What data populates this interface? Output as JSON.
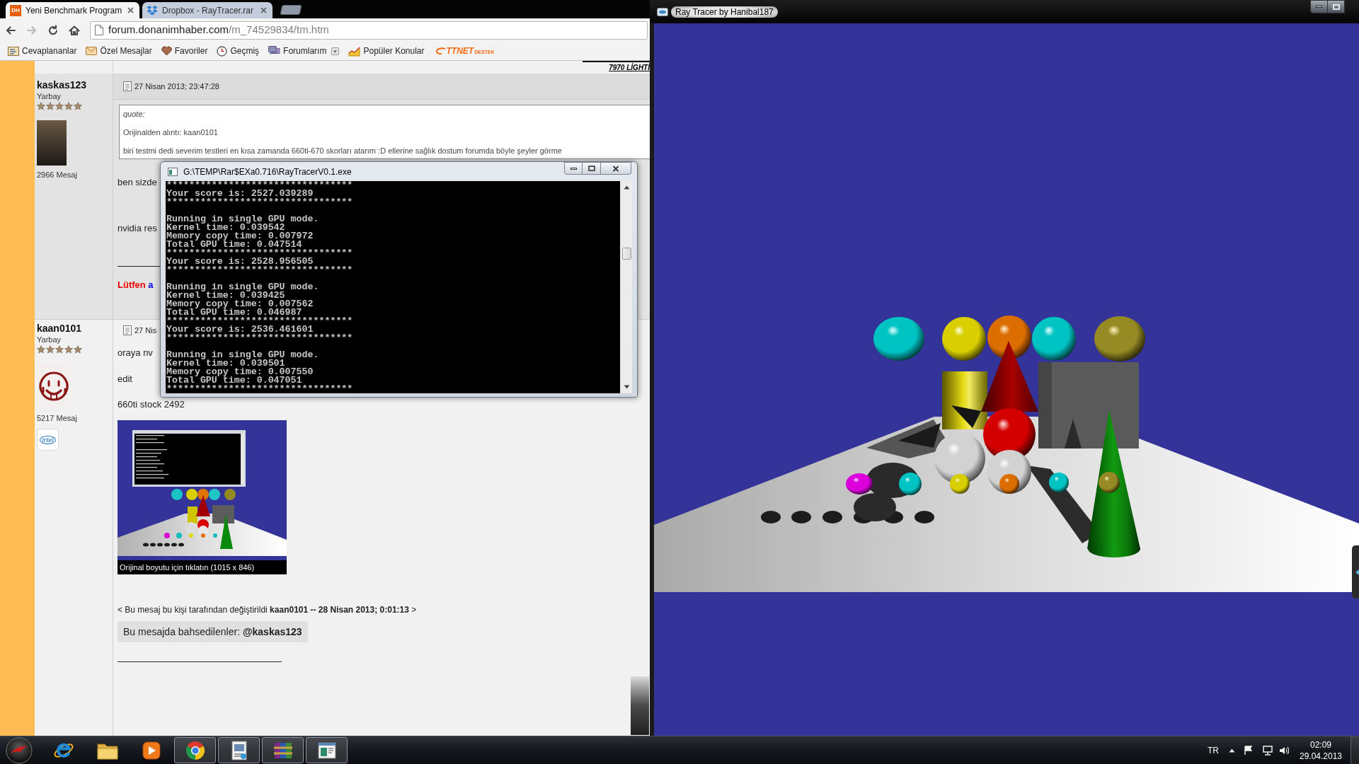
{
  "browser": {
    "tabs": [
      {
        "favicon_text": "DH",
        "title": "Yeni Benchmark Program",
        "selected": true
      },
      {
        "title": "Dropbox - RayTracer.rar",
        "selected": false
      }
    ],
    "nav": [
      {
        "kind": "back",
        "disabled": false
      },
      {
        "kind": "forward",
        "disabled": true
      },
      {
        "kind": "reload",
        "disabled": false
      },
      {
        "kind": "home",
        "disabled": false
      }
    ],
    "address": {
      "host": "forum.donanimhaber.com",
      "path": "/m_74529834/tm.htm"
    },
    "bookmarks": [
      {
        "kind": "link",
        "label": "Cevaplananlar"
      },
      {
        "kind": "link",
        "label": "Özel Mesajlar"
      },
      {
        "kind": "link",
        "label": "Favoriler"
      },
      {
        "kind": "link",
        "label": "Geçmiş"
      },
      {
        "kind": "menu",
        "label": "Forumlarım"
      },
      {
        "kind": "link",
        "label": "Popüler Konular"
      },
      {
        "kind": "logo",
        "label": "TTNET",
        "sublabel": "DESTEK"
      }
    ]
  },
  "forum": {
    "corner_text": "7970 LİGHTİ",
    "posts": [
      {
        "author": "kaskas123",
        "rank": "Yarbay",
        "stars": 5,
        "avatar": {
          "kind": "photo"
        },
        "post_count": "2966 Mesaj",
        "date": "27 Nisan 2013; 23:47:28",
        "body": [
          {
            "kind": "quote",
            "label": "quote:",
            "source": "Orijinalden alıntı: kaan0101",
            "text": "biri testmi dedi severim testleri en kısa zamanda 660ti-670 skorları atarım :D ellerine sağlık dostum forumda böyle şeyler görme"
          },
          {
            "kind": "text",
            "text": "ben sizde"
          },
          {
            "kind": "text",
            "text": "nvidia res"
          },
          {
            "kind": "rule"
          },
          {
            "kind": "notice",
            "lead": "Lütfen",
            "link": "a"
          }
        ]
      },
      {
        "author": "kaan0101",
        "rank": "Yarbay",
        "stars": 5,
        "avatar": {
          "kind": "smiley"
        },
        "badge": "intel",
        "post_count": "5217 Mesaj",
        "date": "27 Nis",
        "body": [
          {
            "kind": "text",
            "text": "oraya nv"
          },
          {
            "kind": "text",
            "text": "edit"
          },
          {
            "kind": "text",
            "text": "660ti stock 2492"
          },
          {
            "kind": "image",
            "caption": "Orijinal boyutu için tıklatın (1015 x 846)"
          },
          {
            "kind": "edit_note",
            "text": "< Bu mesaj bu kişi tarafından değiştirildi **kaan0101 -- 28 Nisan 2013; 0:01:13** >"
          },
          {
            "kind": "mentions",
            "text": "Bu mesajda bahsedilenler: **@kaskas123**"
          },
          {
            "kind": "rule"
          },
          {
            "kind": "signature_image"
          }
        ]
      }
    ]
  },
  "console": {
    "title": "G:\\TEMP\\Rar$EXa0.716\\RayTracerV0.1.exe",
    "blocks": [
      [
        "*********************************",
        "Your score is: 2527.039289",
        "*********************************"
      ],
      [
        "Running in single GPU mode.",
        "Kernel time: 0.039542",
        "Memory copy time: 0.007972",
        "Total GPU time: 0.047514",
        "*********************************",
        "Your score is: 2528.956505",
        "*********************************"
      ],
      [
        "Running in single GPU mode.",
        "Kernel time: 0.039425",
        "Memory copy time: 0.007562",
        "Total GPU time: 0.046987",
        "*********************************",
        "Your score is: 2536.461601",
        "*********************************"
      ],
      [
        "Running in single GPU mode.",
        "Kernel time: 0.039501",
        "Memory copy time: 0.007550",
        "Total GPU time: 0.047051",
        "*********************************"
      ]
    ]
  },
  "raytracer": {
    "title": "Ray Tracer by Hanibal187"
  },
  "taskbar": {
    "items": [
      {
        "running": false
      },
      {
        "running": false
      },
      {
        "running": false
      },
      {
        "running": true
      },
      {
        "running": true
      },
      {
        "running": true
      },
      {
        "running": true
      }
    ],
    "language": "TR",
    "time": "02:09",
    "date": "29.04.2013"
  }
}
